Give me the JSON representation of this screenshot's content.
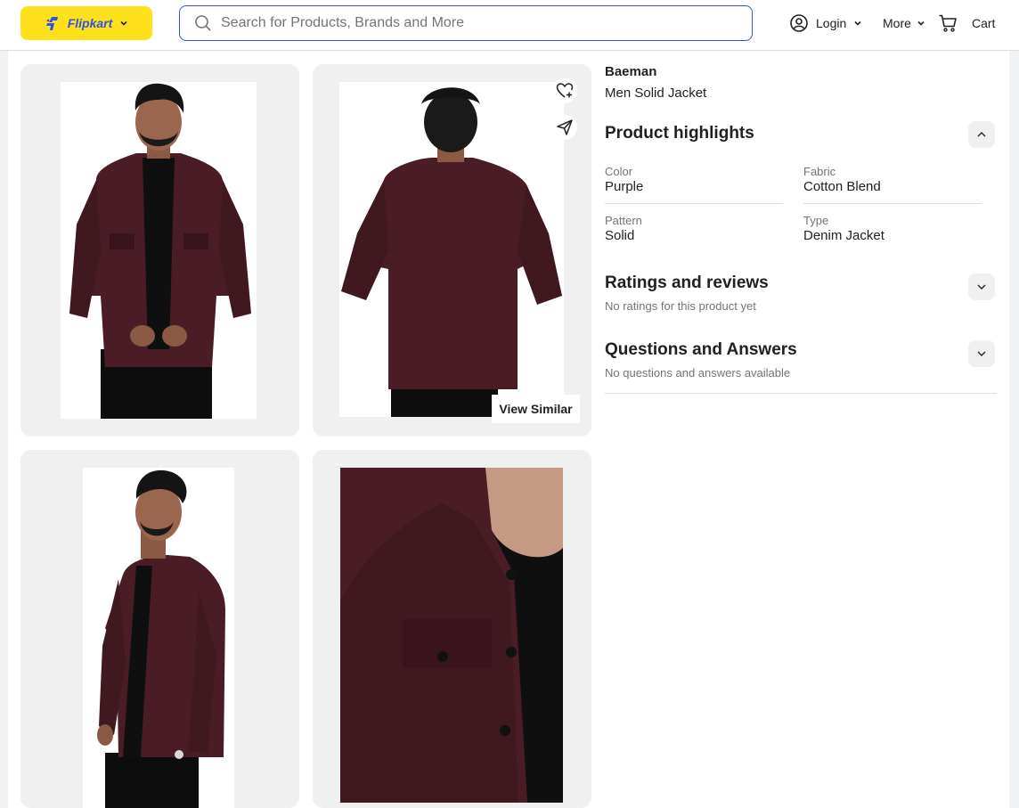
{
  "header": {
    "logo_label": "Flipkart",
    "search_placeholder": "Search for Products, Brands and More",
    "login_label": "Login",
    "more_label": "More",
    "cart_label": "Cart"
  },
  "gallery": {
    "view_similar_label": "View Similar"
  },
  "product": {
    "brand": "Baeman",
    "title": "Men Solid Jacket"
  },
  "highlights": {
    "title": "Product highlights",
    "specs": [
      {
        "label": "Color",
        "value": "Purple"
      },
      {
        "label": "Fabric",
        "value": "Cotton Blend"
      },
      {
        "label": "Pattern",
        "value": "Solid"
      },
      {
        "label": "Type",
        "value": "Denim Jacket"
      }
    ]
  },
  "ratings": {
    "title": "Ratings and reviews",
    "subtitle": "No ratings for this product yet"
  },
  "qna": {
    "title": "Questions and Answers",
    "subtitle": "No questions and answers available"
  },
  "colors": {
    "brand_yellow": "#ffe11b",
    "brand_blue": "#2a55e5",
    "jacket_maroon": "#4a1d26"
  }
}
